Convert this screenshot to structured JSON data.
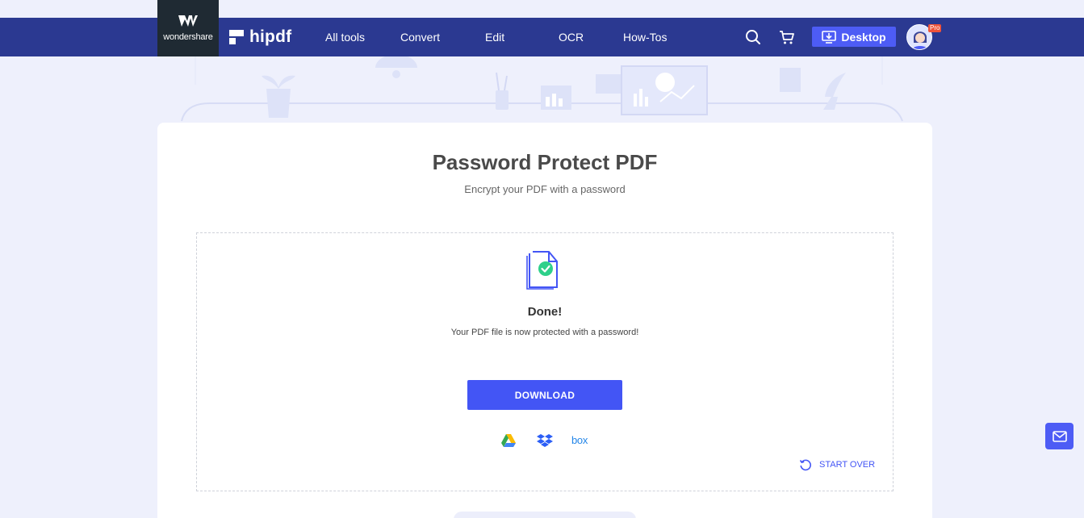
{
  "brand": {
    "parent_name": "wondershare",
    "product_name": "hipdf"
  },
  "nav": {
    "items": [
      {
        "label": "All tools"
      },
      {
        "label": "Convert"
      },
      {
        "label": "Edit"
      },
      {
        "label": "OCR"
      },
      {
        "label": "How-Tos"
      }
    ],
    "desktop_label": "Desktop",
    "pro_badge": "Pro"
  },
  "main": {
    "title": "Password Protect PDF",
    "subtitle": "Encrypt your PDF with a password",
    "done_title": "Done!",
    "done_message": "Your PDF file is now protected with a password!",
    "download_label": "DOWNLOAD",
    "cloud_services": [
      "google-drive",
      "dropbox",
      "box"
    ],
    "box_label": "box",
    "start_over_label": "START OVER"
  },
  "colors": {
    "nav_bg": "#2b3991",
    "accent": "#4355f5",
    "page_bg": "#eef0fc"
  }
}
